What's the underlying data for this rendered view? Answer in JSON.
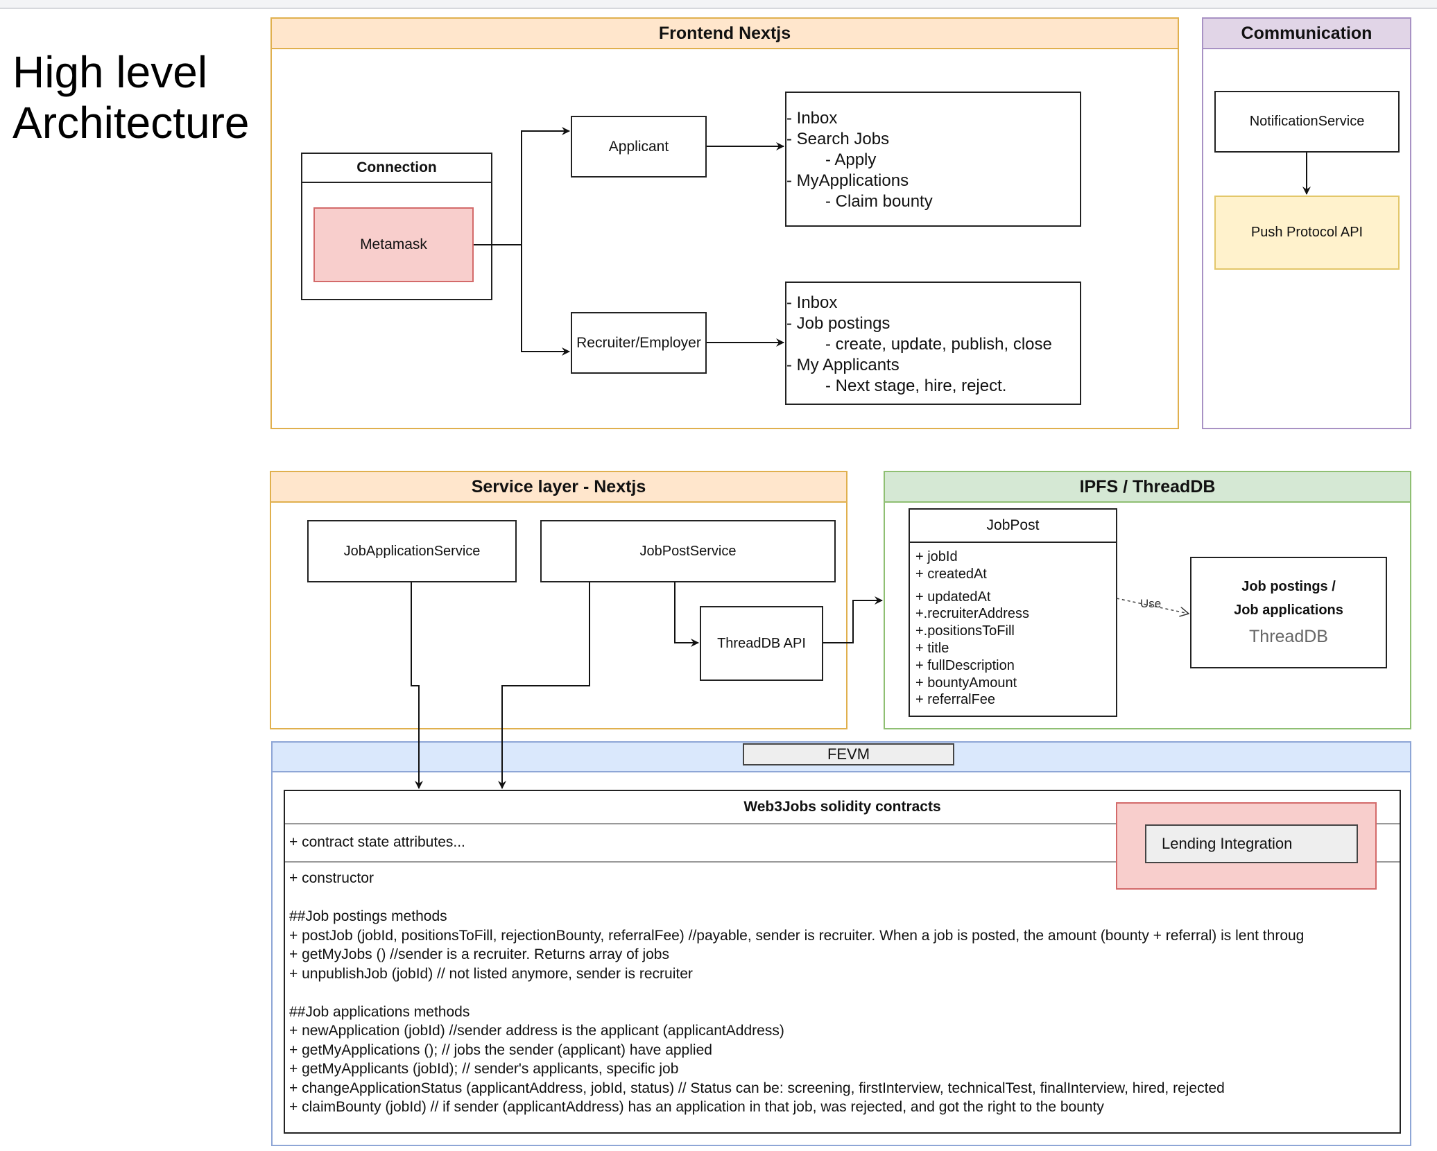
{
  "page": {
    "title_line1": "High level",
    "title_line2": "Architecture"
  },
  "frontend": {
    "title": "Frontend Nextjs",
    "connection": {
      "title": "Connection",
      "metamask": "Metamask"
    },
    "applicant": {
      "label": "Applicant",
      "features": [
        {
          "text": "- Inbox",
          "indent": 0
        },
        {
          "text": "- Search Jobs",
          "indent": 0
        },
        {
          "text": "- Apply",
          "indent": 1
        },
        {
          "text": "- MyApplications",
          "indent": 0
        },
        {
          "text": "- Claim bounty",
          "indent": 1
        }
      ]
    },
    "recruiter": {
      "label": "Recruiter/Employer",
      "features": [
        {
          "text": "- Inbox",
          "indent": 0
        },
        {
          "text": "- Job postings",
          "indent": 0
        },
        {
          "text": "- create, update, publish, close",
          "indent": 1
        },
        {
          "text": "- My Applicants",
          "indent": 0
        },
        {
          "text": "- Next stage, hire, reject.",
          "indent": 1
        }
      ]
    }
  },
  "communication": {
    "title": "Communication",
    "notification_service": "NotificationService",
    "push_protocol": "Push Protocol API"
  },
  "service_layer": {
    "title": "Service layer - Nextjs",
    "job_application_service": "JobApplicationService",
    "job_post_service": "JobPostService",
    "threaddb_api": "ThreadDB API"
  },
  "ipfs": {
    "title": "IPFS / ThreadDB",
    "jobpost": {
      "title": "JobPost",
      "attributes": [
        "+ jobId",
        "+ createdAt",
        "+ updatedAt",
        "+.recruiterAddress",
        "+.positionsToFill",
        "+ title",
        "+ fullDescription",
        "+ bountyAmount",
        "+ referralFee"
      ]
    },
    "use_label": "Use",
    "store": {
      "line1": "Job postings /",
      "line2": "Job applications",
      "subtitle": "ThreadDB"
    }
  },
  "fevm": {
    "title": "FEVM",
    "contract": {
      "title": "Web3Jobs solidity contracts",
      "state": "+ contract state attributes...",
      "lines": [
        "+ constructor",
        "",
        "##Job postings methods",
        "+ postJob (jobId, positionsToFill, rejectionBounty, referralFee) //payable, sender is recruiter. When a job is posted, the amount (bounty + referral) is lent throug",
        "+ getMyJobs () //sender is a recruiter. Returns array of jobs",
        "+ unpublishJob (jobId) // not listed anymore, sender is recruiter",
        "",
        "##Job applications methods",
        "+ newApplication (jobId) //sender address is the applicant (applicantAddress)",
        "+ getMyApplications (); // jobs the sender (applicant) have applied",
        "+ getMyApplicants (jobId); // sender's applicants, specific job",
        "+ changeApplicationStatus (applicantAddress, jobId, status) //  Status can be: screening, firstInterview, technicalTest, finalInterview, hired, rejected",
        "+ claimBounty (jobId) // if sender (applicantAddress) has an application in that job, was rejected, and got the right to the bounty"
      ]
    },
    "lending": "Lending Integration"
  },
  "colors": {
    "frontend_border": "#e0b04e",
    "frontend_header": "#ffe6cc",
    "communication_header": "#e1d5e7",
    "ipfs_header": "#d5e8d4",
    "fevm_header": "#dae8fc",
    "metamask_fill": "#f8cecc",
    "push_fill": "#fff2cc",
    "lending_fill": "#f8cecc"
  }
}
